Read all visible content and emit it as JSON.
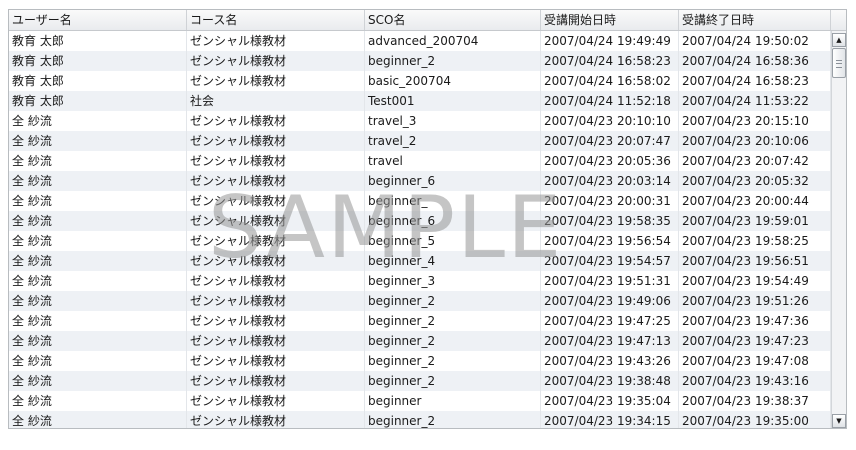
{
  "columns": [
    "ユーザー名",
    "コース名",
    "SCO名",
    "受講開始日時",
    "受講終了日時"
  ],
  "rows": [
    [
      "教育 太郎",
      "ゼンシャル様教材",
      "advanced_200704",
      "2007/04/24 19:49:49",
      "2007/04/24 19:50:02"
    ],
    [
      "教育 太郎",
      "ゼンシャル様教材",
      "beginner_2",
      "2007/04/24 16:58:23",
      "2007/04/24 16:58:36"
    ],
    [
      "教育 太郎",
      "ゼンシャル様教材",
      "basic_200704",
      "2007/04/24 16:58:02",
      "2007/04/24 16:58:23"
    ],
    [
      "教育 太郎",
      "社会",
      "Test001",
      "2007/04/24 11:52:18",
      "2007/04/24 11:53:22"
    ],
    [
      "全 紗流",
      "ゼンシャル様教材",
      "travel_3",
      "2007/04/23 20:10:10",
      "2007/04/23 20:15:10"
    ],
    [
      "全 紗流",
      "ゼンシャル様教材",
      "travel_2",
      "2007/04/23 20:07:47",
      "2007/04/23 20:10:06"
    ],
    [
      "全 紗流",
      "ゼンシャル様教材",
      "travel",
      "2007/04/23 20:05:36",
      "2007/04/23 20:07:42"
    ],
    [
      "全 紗流",
      "ゼンシャル様教材",
      "beginner_6",
      "2007/04/23 20:03:14",
      "2007/04/23 20:05:32"
    ],
    [
      "全 紗流",
      "ゼンシャル様教材",
      "beginner_",
      "2007/04/23 20:00:31",
      "2007/04/23 20:00:44"
    ],
    [
      "全 紗流",
      "ゼンシャル様教材",
      "beginner_6",
      "2007/04/23 19:58:35",
      "2007/04/23 19:59:01"
    ],
    [
      "全 紗流",
      "ゼンシャル様教材",
      "beginner_5",
      "2007/04/23 19:56:54",
      "2007/04/23 19:58:25"
    ],
    [
      "全 紗流",
      "ゼンシャル様教材",
      "beginner_4",
      "2007/04/23 19:54:57",
      "2007/04/23 19:56:51"
    ],
    [
      "全 紗流",
      "ゼンシャル様教材",
      "beginner_3",
      "2007/04/23 19:51:31",
      "2007/04/23 19:54:49"
    ],
    [
      "全 紗流",
      "ゼンシャル様教材",
      "beginner_2",
      "2007/04/23 19:49:06",
      "2007/04/23 19:51:26"
    ],
    [
      "全 紗流",
      "ゼンシャル様教材",
      "beginner_2",
      "2007/04/23 19:47:25",
      "2007/04/23 19:47:36"
    ],
    [
      "全 紗流",
      "ゼンシャル様教材",
      "beginner_2",
      "2007/04/23 19:47:13",
      "2007/04/23 19:47:23"
    ],
    [
      "全 紗流",
      "ゼンシャル様教材",
      "beginner_2",
      "2007/04/23 19:43:26",
      "2007/04/23 19:47:08"
    ],
    [
      "全 紗流",
      "ゼンシャル様教材",
      "beginner_2",
      "2007/04/23 19:38:48",
      "2007/04/23 19:43:16"
    ],
    [
      "全 紗流",
      "ゼンシャル様教材",
      "beginner",
      "2007/04/23 19:35:04",
      "2007/04/23 19:38:37"
    ],
    [
      "全 紗流",
      "ゼンシャル様教材",
      "beginner_2",
      "2007/04/23 19:34:15",
      "2007/04/23 19:35:00"
    ]
  ],
  "scrollbar": {
    "position": 0
  },
  "watermark": "SAMPLE"
}
